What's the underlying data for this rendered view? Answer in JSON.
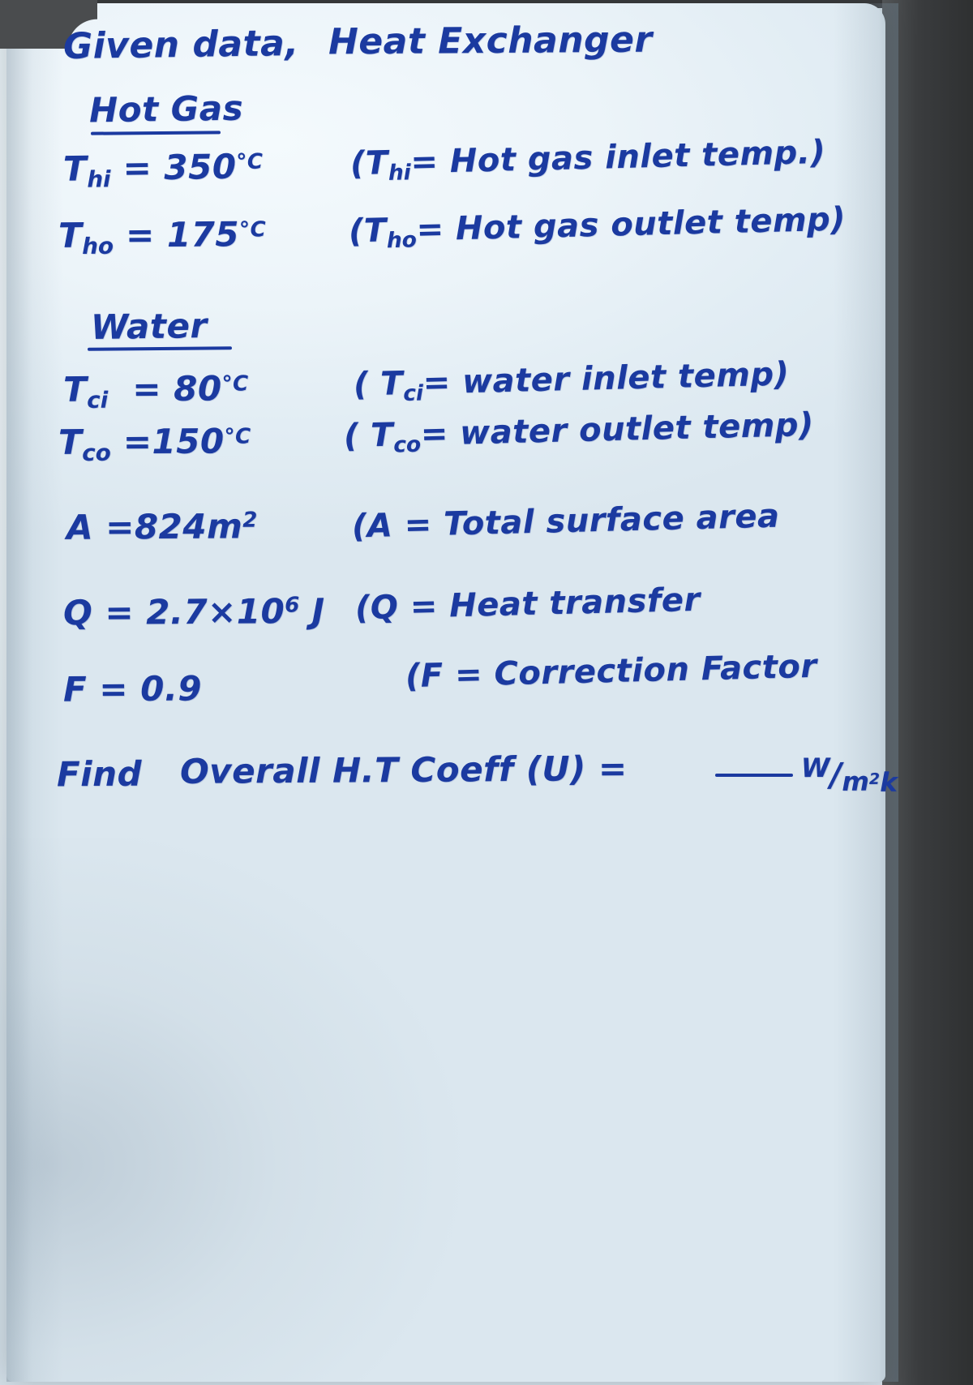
{
  "document": {
    "type": "handwritten-note",
    "ink_color": "#1b3aa0",
    "paper_color": "#eaf3f8",
    "title_left": "Given data,",
    "title_right": "Heat Exchanger",
    "sections": [
      {
        "heading": "Hot Gas",
        "underlined": true,
        "rows": [
          {
            "symbol": "Thi",
            "symbol_base": "T",
            "symbol_sub": "hi",
            "equals": "=",
            "value": "350",
            "unit": "°C",
            "note": "(Thi = Hot gas inlet temp.)",
            "note_base": "T",
            "note_sub": "hi",
            "note_text": "Hot gas inlet temp.)"
          },
          {
            "symbol": "Tho",
            "symbol_base": "T",
            "symbol_sub": "ho",
            "equals": "=",
            "value": "175",
            "unit": "°C",
            "note": "(Tho = Hot gas outlet temp)",
            "note_base": "T",
            "note_sub": "ho",
            "note_text": "Hot gas outlet temp)"
          }
        ]
      },
      {
        "heading": "Water",
        "underlined": true,
        "rows": [
          {
            "symbol": "Tci",
            "symbol_base": "T",
            "symbol_sub": "ci",
            "equals": "=",
            "value": "80",
            "unit": "°C",
            "note": "(Tci = water inlet temp)",
            "note_base": "T",
            "note_sub": "ci",
            "note_text": "water inlet temp)"
          },
          {
            "symbol": "Tco",
            "symbol_base": "T",
            "symbol_sub": "co",
            "equals": "=",
            "value": "150",
            "unit": "°C",
            "note": "(Tco = water outlet temp)",
            "note_base": "T",
            "note_sub": "co",
            "note_text": "water outlet temp)"
          }
        ]
      }
    ],
    "extra_rows": [
      {
        "symbol": "A",
        "equals": "=",
        "value": "824",
        "unit": "m",
        "unit_sup": "2",
        "note": "(A = Total surface area"
      },
      {
        "symbol": "Q",
        "equals": "=",
        "value": "2.7×10",
        "value_sup": "6",
        "unit": "J",
        "note": "(Q = Heat transfer"
      },
      {
        "symbol": "F",
        "equals": "=",
        "value": "0.9",
        "unit": "",
        "note": "(F = Correction Factor"
      }
    ],
    "find_line": {
      "prefix": "Find",
      "question": "Overall H.T Coeff (U) =",
      "blank": "______",
      "unit_num": "W",
      "unit_den": "m",
      "unit_den_sup": "2",
      "unit_den_tail": "k",
      "unit_full": "W/m²k"
    }
  }
}
